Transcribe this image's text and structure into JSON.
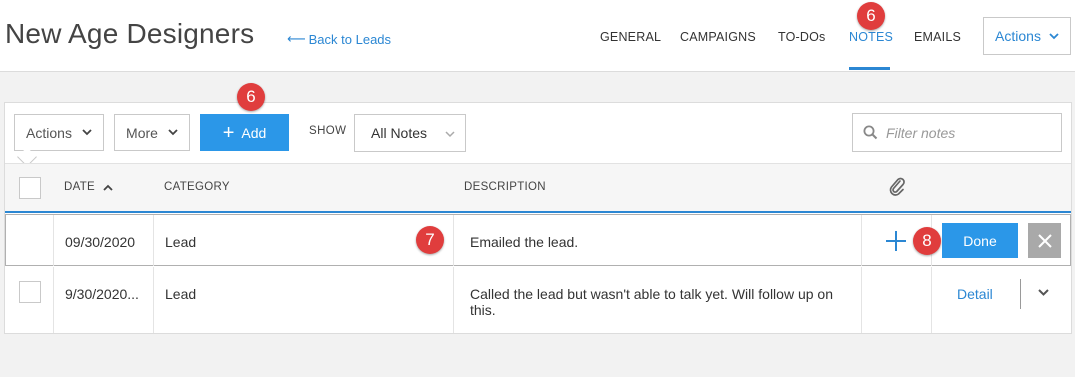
{
  "header": {
    "title": "New Age Designers",
    "back_link": "Back to Leads",
    "tabs": [
      {
        "label": "GENERAL"
      },
      {
        "label": "CAMPAIGNS"
      },
      {
        "label": "TO-DOs"
      },
      {
        "label": "NOTES",
        "active": true
      },
      {
        "label": "EMAILS"
      }
    ],
    "actions_label": "Actions"
  },
  "toolbar": {
    "actions_label": "Actions",
    "more_label": "More",
    "add_label": "Add",
    "show_label": "SHOW",
    "show_value": "All Notes",
    "filter_placeholder": "Filter notes"
  },
  "table": {
    "columns": [
      "DATE",
      "CATEGORY",
      "DESCRIPTION"
    ],
    "rows": [
      {
        "date": "09/30/2020",
        "category": "Lead",
        "description": "Emailed the lead.",
        "done_label": "Done"
      },
      {
        "date": "9/30/2020...",
        "category": "Lead",
        "description": "Called the lead but wasn't able to talk yet. Will follow up on this.",
        "detail_label": "Detail"
      }
    ]
  },
  "annotations": {
    "badge_notes": "6",
    "badge_add": "6",
    "badge_row": "7",
    "badge_done": "8"
  },
  "colors": {
    "accent": "#2b87d3",
    "button_primary": "#2b97e8",
    "badge": "#e03d3d",
    "close_button": "#a9a9a9"
  }
}
